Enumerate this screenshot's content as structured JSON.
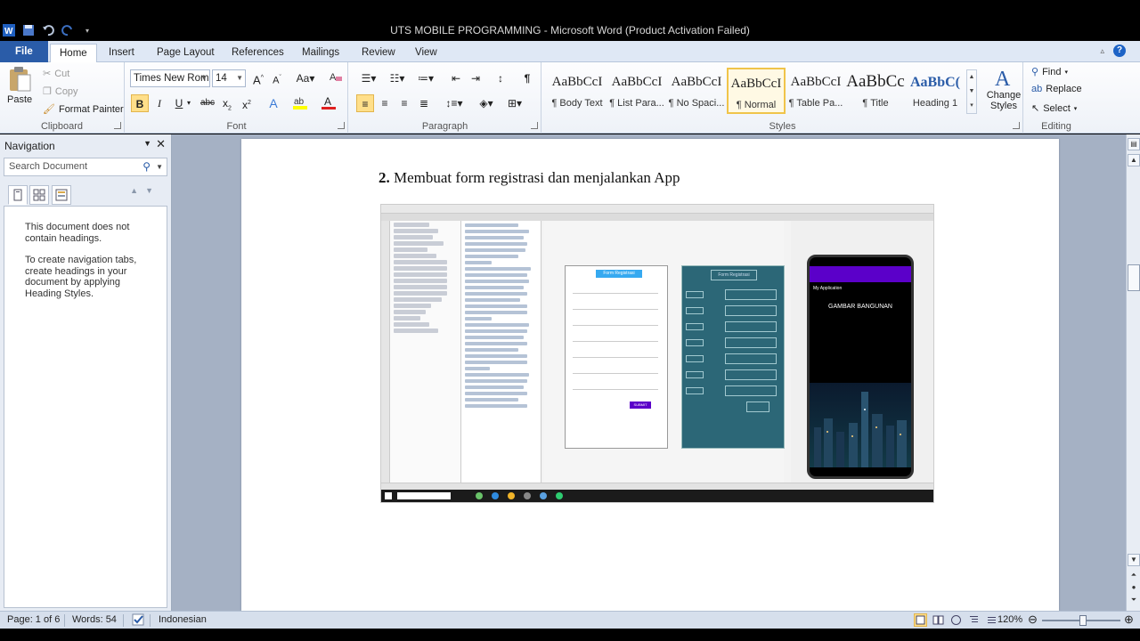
{
  "window": {
    "title": "UTS MOBILE PROGRAMMING  -  Microsoft Word (Product Activation Failed)"
  },
  "tabs": [
    {
      "label": "File"
    },
    {
      "label": "Home"
    },
    {
      "label": "Insert"
    },
    {
      "label": "Page Layout"
    },
    {
      "label": "References"
    },
    {
      "label": "Mailings"
    },
    {
      "label": "Review"
    },
    {
      "label": "View"
    }
  ],
  "ribbon": {
    "clipboard": {
      "label": "Clipboard",
      "paste": "Paste",
      "cut": "Cut",
      "copy": "Copy",
      "format_painter": "Format Painter"
    },
    "font": {
      "label": "Font",
      "font_name": "Times New Rom",
      "font_size": "14"
    },
    "paragraph": {
      "label": "Paragraph"
    },
    "styles": {
      "label": "Styles",
      "items": [
        {
          "sample": "AaBbCcI",
          "name": "¶ Body Text"
        },
        {
          "sample": "AaBbCcI",
          "name": "¶ List Para..."
        },
        {
          "sample": "AaBbCcI",
          "name": "¶ No Spaci..."
        },
        {
          "sample": "AaBbCcI",
          "name": "¶ Normal"
        },
        {
          "sample": "AaBbCcI",
          "name": "¶ Table Pa..."
        },
        {
          "sample": "AaBbCc",
          "name": "¶ Title"
        },
        {
          "sample": "AaBbC(",
          "name": "Heading 1"
        }
      ],
      "change_styles": "Change Styles"
    },
    "editing": {
      "label": "Editing",
      "find": "Find",
      "replace": "Replace",
      "select": "Select"
    }
  },
  "navigation": {
    "title": "Navigation",
    "search_placeholder": "Search Document",
    "message1": "This document does not contain headings.",
    "message2": "To create navigation tabs, create headings in your document by applying Heading Styles."
  },
  "document": {
    "heading_number": "2.",
    "heading_text": " Membuat form registrasi dan menjalankan App",
    "screenshot": {
      "form_title": "Form Registrasi",
      "form_title_blue": "Form Registrasi",
      "app_title": "My Application",
      "app_heading": "GAMBAR BANGUNAN",
      "submit": "SUBMIT"
    }
  },
  "statusbar": {
    "page": "Page: 1 of 6",
    "words": "Words: 54",
    "language": "Indonesian",
    "zoom": "120%"
  },
  "colors": {
    "file_tab": "#2a5ca8",
    "ribbon_bg": "#dfe8f5",
    "selection": "#ffdf8a"
  }
}
